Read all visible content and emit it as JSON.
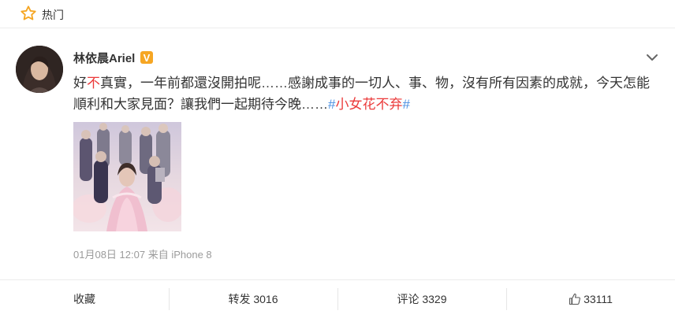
{
  "header": {
    "label": "热门",
    "icon": "star-icon",
    "accent": "#f5a623"
  },
  "post": {
    "author": "林依晨Ariel",
    "verified_badge": "V",
    "verified_color": "#f6a623",
    "text_parts": [
      "好",
      "不",
      "真實，一年前都還沒開拍呢……感謝成事的一切人、事、物，沒有所有因素的成就，今天怎能順利和大家見面？讓我們一起期待今晚……",
      "#",
      "小女花不弃",
      "#"
    ],
    "date": "01月08日 12:07",
    "source": "来自 iPhone 8"
  },
  "actions": {
    "favorite": "收藏",
    "repost": "转发 3016",
    "comment": "评论 3329",
    "like": "33111"
  },
  "colors": {
    "link": "#eb3a3a",
    "hash": "#4a90e2",
    "meta": "#9b9b9b"
  }
}
